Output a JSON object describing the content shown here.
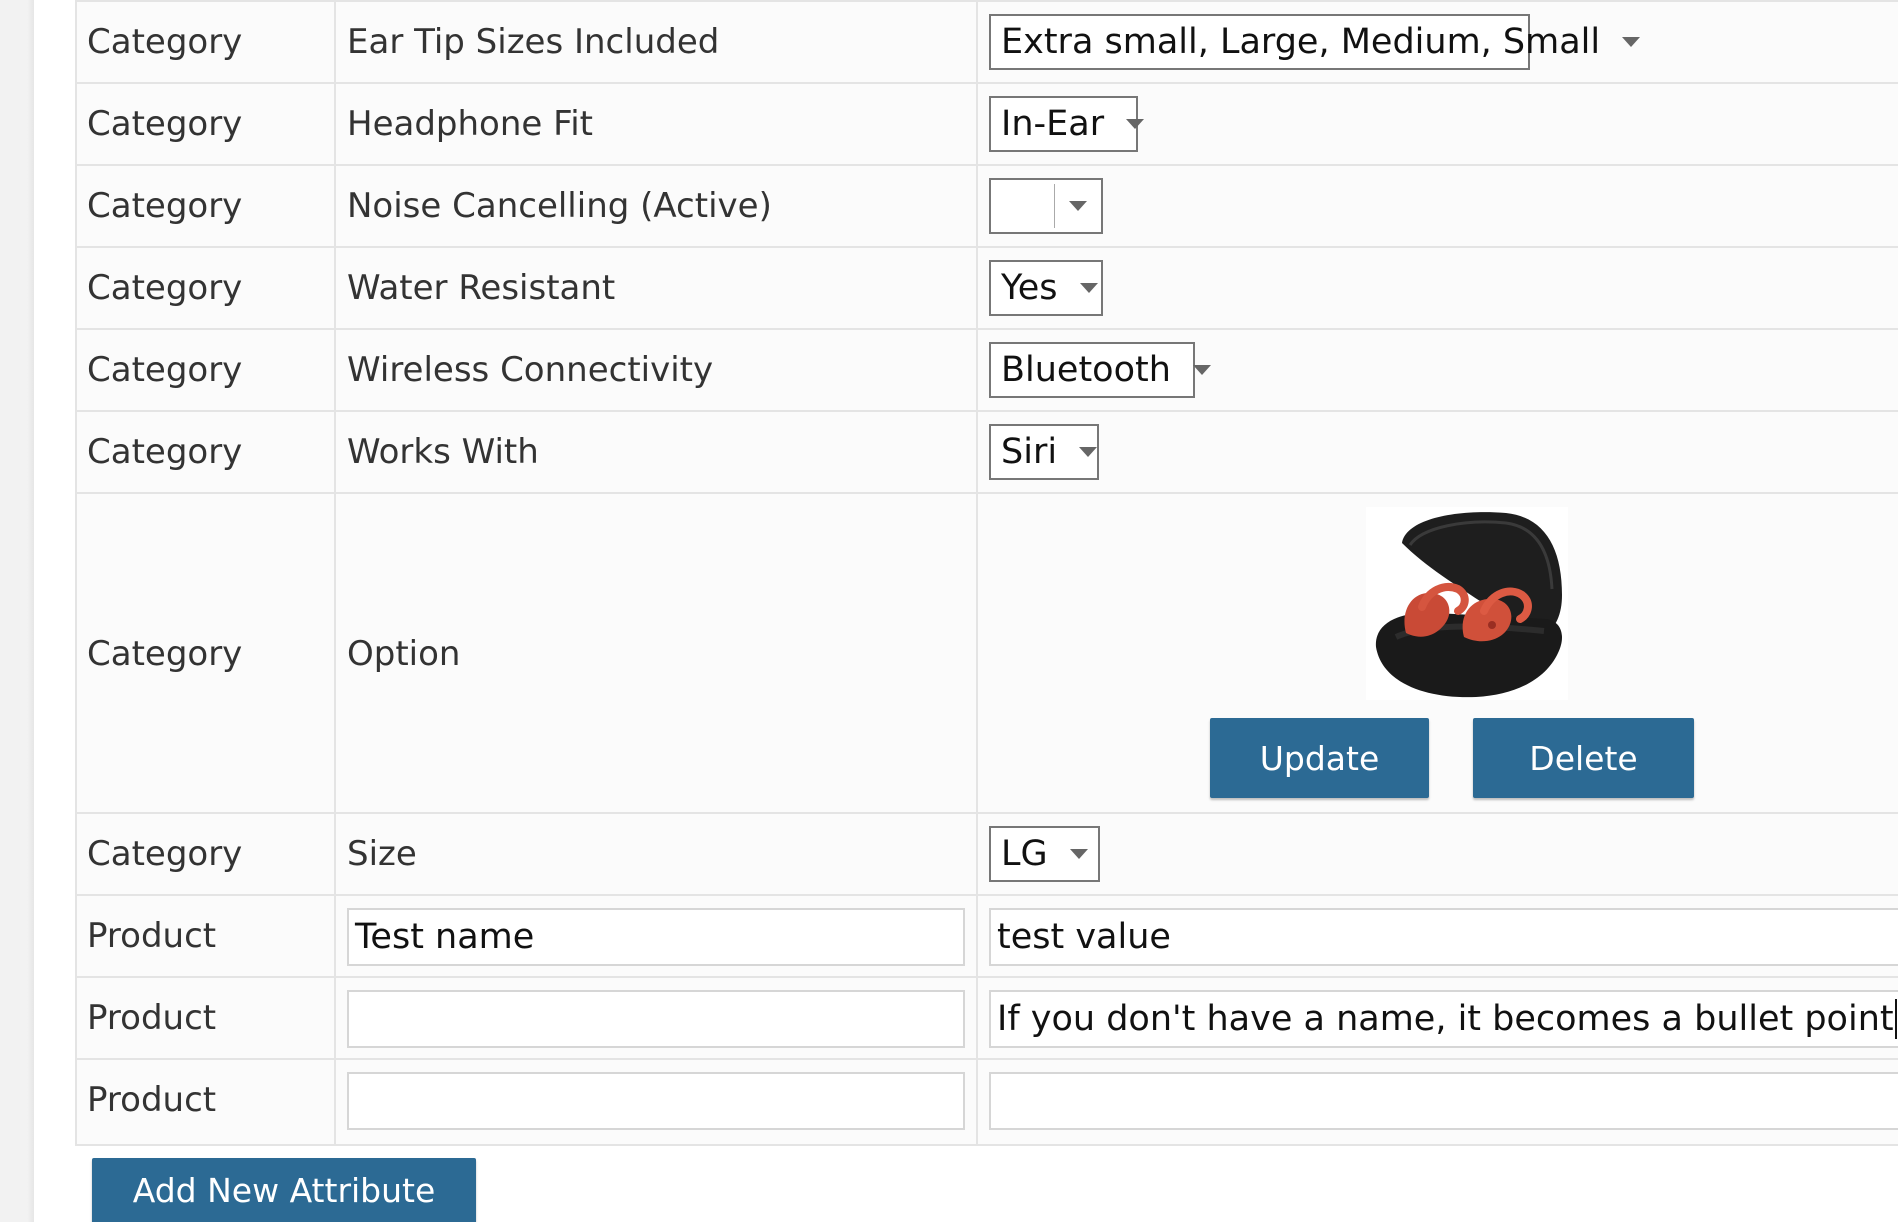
{
  "rows": [
    {
      "type": "Category",
      "name": "Ear Tip Sizes Included",
      "value": "Extra small, Large, Medium, Small"
    },
    {
      "type": "Category",
      "name": "Headphone Fit",
      "value": "In-Ear"
    },
    {
      "type": "Category",
      "name": "Noise Cancelling (Active)",
      "value": ""
    },
    {
      "type": "Category",
      "name": "Water Resistant",
      "value": "Yes"
    },
    {
      "type": "Category",
      "name": "Wireless Connectivity",
      "value": "Bluetooth"
    },
    {
      "type": "Category",
      "name": "Works With",
      "value": "Siri"
    },
    {
      "type": "Category",
      "name": "Option",
      "image": "earbuds-case-image"
    },
    {
      "type": "Category",
      "name": "Size",
      "value": "LG"
    },
    {
      "type": "Product",
      "name": "Test name",
      "value": "test value"
    },
    {
      "type": "Product",
      "name": "",
      "value": "If you don't have a name, it becomes a bullet point"
    },
    {
      "type": "Product",
      "name": "",
      "value": ""
    }
  ],
  "buttons": {
    "update": "Update",
    "delete": "Delete",
    "add_new": "Add New Attribute"
  },
  "colors": {
    "button_bg": "#2c6a94",
    "border": "#e4e4e4"
  }
}
